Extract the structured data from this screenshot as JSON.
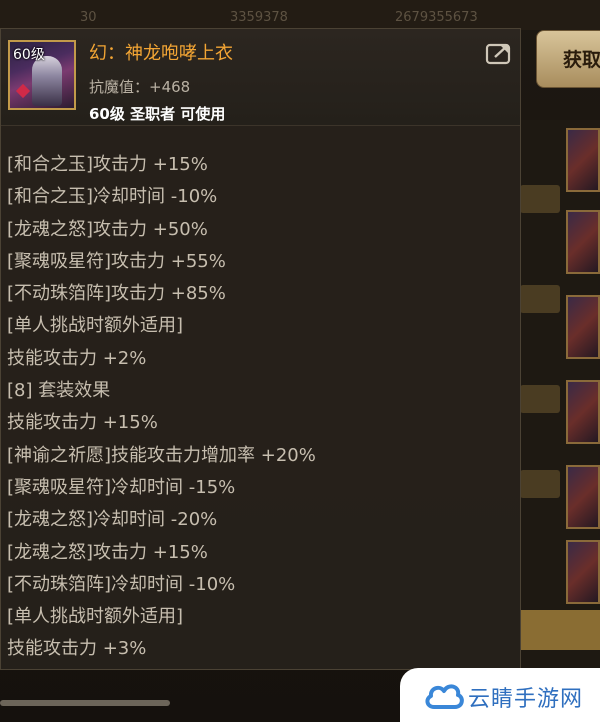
{
  "background": {
    "get_button_label": "获取",
    "topbar_values": [
      "30",
      "3359378",
      "2679355673"
    ]
  },
  "item": {
    "level_badge": "60级",
    "name": "幻：神龙咆哮上衣",
    "stat_label": "抗魔值：",
    "stat_value": "+468",
    "requirement": "60级 圣职者 可使用",
    "icon": "share-icon"
  },
  "effects": [
    "[和合之玉]攻击力 +15%",
    "[和合之玉]冷却时间 -10%",
    "[龙魂之怒]攻击力 +50%",
    "[聚魂吸星符]攻击力 +55%",
    "[不动珠箔阵]攻击力 +85%",
    "[单人挑战时额外适用]",
    "技能攻击力 +2%",
    "[8] 套装效果",
    "技能攻击力 +15%",
    "[神谕之祈愿]技能攻击力增加率 +20%",
    "[聚魂吸星符]冷却时间 -15%",
    "[龙魂之怒]冷却时间 -20%",
    "[龙魂之怒]攻击力 +15%",
    "[不动珠箔阵]冷却时间 -10%",
    "[单人挑战时额外适用]",
    "技能攻击力 +3%"
  ],
  "watermark": {
    "text": "云睛手游网"
  },
  "colors": {
    "item_name": "#f3a534",
    "effect_text": "#c7beaf",
    "requirement_text": "#ffffff",
    "watermark_text": "#2f6fbf"
  }
}
